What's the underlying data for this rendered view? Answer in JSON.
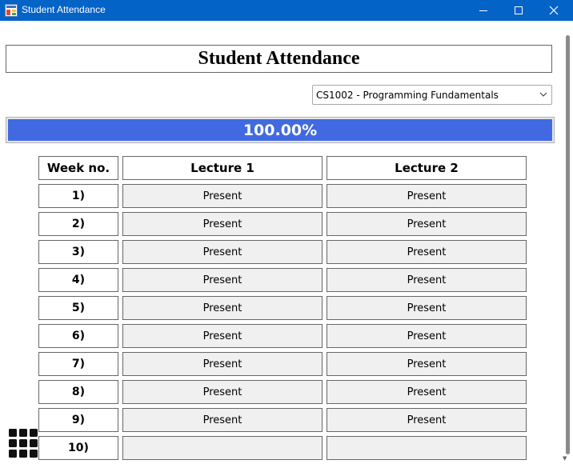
{
  "window": {
    "title": "Student Attendance"
  },
  "heading": "Student Attendance",
  "course_select": {
    "selected": "CS1002 - Programming Fundamentals",
    "icon": "chevron-down-icon"
  },
  "progress": {
    "label": "100.00%",
    "fraction": 1.0,
    "color": "#4169e1"
  },
  "table": {
    "headers": [
      "Week no.",
      "Lecture 1",
      "Lecture 2"
    ],
    "rows": [
      {
        "week": "1)",
        "lecture1": "Present",
        "lecture2": "Present"
      },
      {
        "week": "2)",
        "lecture1": "Present",
        "lecture2": "Present"
      },
      {
        "week": "3)",
        "lecture1": "Present",
        "lecture2": "Present"
      },
      {
        "week": "4)",
        "lecture1": "Present",
        "lecture2": "Present"
      },
      {
        "week": "5)",
        "lecture1": "Present",
        "lecture2": "Present"
      },
      {
        "week": "6)",
        "lecture1": "Present",
        "lecture2": "Present"
      },
      {
        "week": "7)",
        "lecture1": "Present",
        "lecture2": "Present"
      },
      {
        "week": "8)",
        "lecture1": "Present",
        "lecture2": "Present"
      },
      {
        "week": "9)",
        "lecture1": "Present",
        "lecture2": "Present"
      },
      {
        "week": "10)",
        "lecture1": "",
        "lecture2": ""
      }
    ]
  },
  "colors": {
    "titlebar": "#0463c6",
    "progress_fill": "#4169e1",
    "cell_background": "#f0f0f0"
  },
  "icons": {
    "app": "app-window-icon",
    "grid": "grid-menu-icon"
  }
}
